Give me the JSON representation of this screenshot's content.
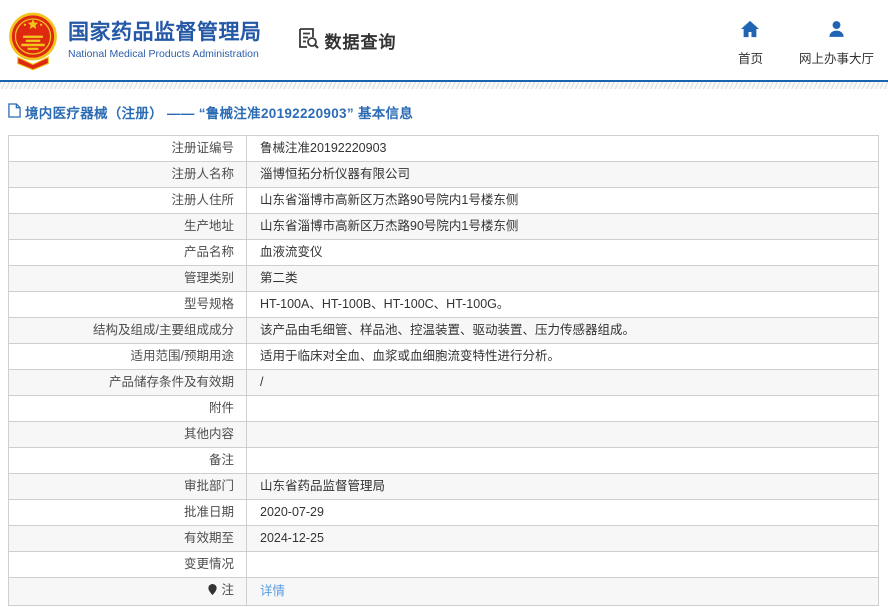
{
  "header": {
    "title": "国家药品监督管理局",
    "subtitle": "National Medical Products Administration",
    "section_label": "数据查询",
    "nav": [
      {
        "label": "首页",
        "icon": "home-icon"
      },
      {
        "label": "网上办事大厅",
        "icon": "user-icon"
      }
    ],
    "logo_icon": "china-national-emblem"
  },
  "breadcrumb": {
    "icon": "document-icon",
    "text": "境内医疗器械（注册） —— “鲁械注准20192220903” 基本信息"
  },
  "table": {
    "rows": [
      {
        "label": "注册证编号",
        "value": "鲁械注准20192220903"
      },
      {
        "label": "注册人名称",
        "value": "淄博恒拓分析仪器有限公司"
      },
      {
        "label": "注册人住所",
        "value": "山东省淄博市高新区万杰路90号院内1号楼东侧"
      },
      {
        "label": "生产地址",
        "value": "山东省淄博市高新区万杰路90号院内1号楼东侧"
      },
      {
        "label": "产品名称",
        "value": "血液流变仪"
      },
      {
        "label": "管理类别",
        "value": "第二类"
      },
      {
        "label": "型号规格",
        "value": "HT-100A、HT-100B、HT-100C、HT-100G。"
      },
      {
        "label": "结构及组成/主要组成成分",
        "value": "该产品由毛细管、样品池、控温装置、驱动装置、压力传感器组成。"
      },
      {
        "label": "适用范围/预期用途",
        "value": "适用于临床对全血、血浆或血细胞流变特性进行分析。"
      },
      {
        "label": "产品储存条件及有效期",
        "value": "/"
      },
      {
        "label": "附件",
        "value": ""
      },
      {
        "label": "其他内容",
        "value": ""
      },
      {
        "label": "备注",
        "value": ""
      },
      {
        "label": "审批部门",
        "value": "山东省药品监督管理局"
      },
      {
        "label": "批准日期",
        "value": "2020-07-29"
      },
      {
        "label": "有效期至",
        "value": "2024-12-25"
      },
      {
        "label": "变更情况",
        "value": ""
      },
      {
        "label": "注",
        "value": "详情",
        "label_icon": "pin-icon",
        "link": true
      }
    ]
  },
  "colors": {
    "header_blue": "#2458a6",
    "rule_blue": "#1a63b0",
    "nav_icon_blue": "#2064b4",
    "breadcrumb_blue": "#2c6cb5",
    "link_blue": "#5a9de0",
    "emblem_red": "#de2910",
    "emblem_gold": "#f2c41d",
    "label_text": "#4d4d4d",
    "value_text": "#333333",
    "border_gray": "#cfcfcf",
    "alt_row_bg": "#f7f7f7"
  }
}
